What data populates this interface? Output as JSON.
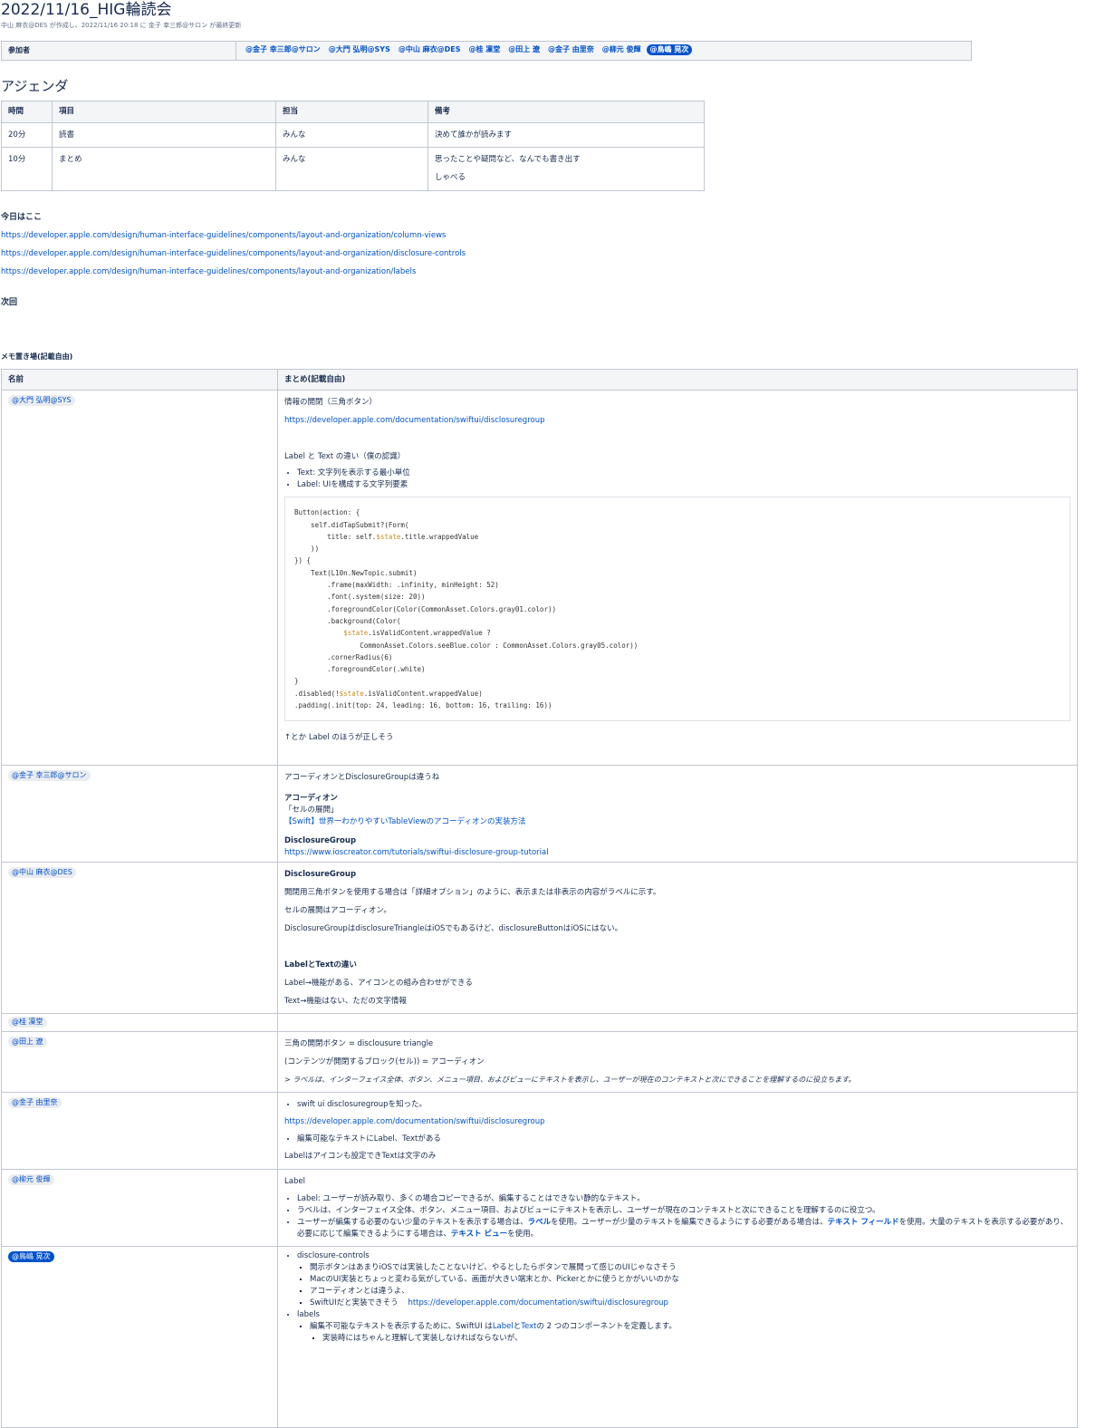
{
  "page": {
    "title": "2022/11/16_HIG輪読会",
    "byline": "中山 麻衣@DES が作成し、2022/11/16 20:18 に 金子 幸三郎@サロン が最終更新"
  },
  "participants": {
    "label": "参加者",
    "mentions": [
      "@金子 幸三郎@サロン",
      "@大門 弘明@SYS",
      "@中山 麻衣@DES",
      "@桂 凜堂",
      "@田上 遼",
      "@金子 由里奈",
      "@柳元 俊輝",
      "@鳥嶋 晃次"
    ]
  },
  "agenda": {
    "heading": "アジェンダ",
    "headers": [
      "時間",
      "項目",
      "担当",
      "備考"
    ],
    "rows": [
      [
        "20分",
        "読書",
        "みんな",
        "決めて誰かが読みます",
        ""
      ],
      [
        "10分",
        "まとめ",
        "みんな",
        "思ったことや疑問など、なんでも書き出す",
        "しゃべる"
      ]
    ]
  },
  "today": {
    "heading": "今日はここ",
    "links": [
      "https://developer.apple.com/design/human-interface-guidelines/components/layout-and-organization/column-views",
      "https://developer.apple.com/design/human-interface-guidelines/components/layout-and-organization/disclosure-controls",
      "https://developer.apple.com/design/human-interface-guidelines/components/layout-and-organization/labels"
    ]
  },
  "next": {
    "heading": "次回"
  },
  "memo": {
    "heading": "メモ置き場(記載自由)",
    "headers": [
      "名前",
      "まとめ(記載自由)"
    ],
    "daimon": {
      "name": "@大門 弘明@SYS",
      "p1": "情報の開閉（三角ボタン）",
      "link1": "https://developer.apple.com/documentation/swiftui/disclosuregroup",
      "p2": "Label と Text の違い（僕の認識）",
      "li1": "Text: 文字列を表示する最小単位",
      "li2": "Label: UIを構成する文字列要素",
      "code": [
        "Button(action: {",
        "    self.didTapSubmit?(Form(",
        "        title: self.",
        "    ))",
        "}) {",
        "    Text(L10n.NewTopic.submit)",
        "        .frame(maxWidth: .infinity, minHeight: 52)",
        "        .font(.system(size: 20))",
        "        .foregroundColor(Color(CommonAsset.Colors.gray01.color))",
        "        .background(Color(",
        "            ",
        "                CommonAsset.Colors.seeBlue.color : CommonAsset.Colors.gray05.color))",
        "        .cornerRadius(6)",
        "        .foregroundColor(.white)",
        "}",
        ".disabled(!",
        ".padding(.init(top: 24, leading: 16, bottom: 16, trailing: 16))"
      ],
      "code_kw": "$state",
      "code_tail": {
        "l3": ".title.wrappedValue",
        "l11": ".isValidContent.wrappedValue ?",
        "l16": ".isValidContent.wrappedValue)"
      },
      "p3": "↑とか Label のほうが正しそう"
    },
    "kaneko": {
      "name": "@金子 幸三郎@サロン",
      "p1": "アコーディオンとDisclosureGroupは違うね",
      "h1": "アコーディオン",
      "p2": "「セルの展開」",
      "link1": "【Swift】世界一わかりやすいTableViewのアコーディオンの実装方法",
      "h2": "DisclosureGroup",
      "link2": "https://www.ioscreator.com/tutorials/swiftui-disclosure-group-tutorial"
    },
    "nakayama": {
      "name": "@中山 麻衣@DES",
      "h1": "DisclosureGroup",
      "p1": "開閉用三角ボタンを使用する場合は「詳細オプション」のように、表示または非表示の内容がラベルに示す。",
      "p2": "セルの展開はアコーディオン。",
      "p3": "DisclosureGroupはdisclosureTriangleはiOSでもあるけど、disclosureButtonはiOSにはない。",
      "h2": "LabelとTextの違い",
      "p4": "Label→機能がある、アイコンとの組み合わせができる",
      "p5": "Text→機能はない、ただの文字情報"
    },
    "katsura": {
      "name": "@桂 凜堂"
    },
    "tagami": {
      "name": "@田上 遼",
      "p1": "三角の開閉ボタン = disclousure triangle",
      "p2": "(コンテンツが開閉するブロック(セル)) = アコーディオン",
      "p3": "> ラベルは、インターフェイス全体、ボタン、メニュー項目、およびビューにテキストを表示し、ユーザーが現在のコンテキストと次にできることを理解するのに役立ちます。"
    },
    "yurina": {
      "name": "@金子 由里奈",
      "li1": "swift ui disclosuregroupを知った。",
      "link1": "https://developer.apple.com/documentation/swiftui/disclosuregroup",
      "li2": "編集可能なテキストにLabel、Textがある",
      "p1": "Labelはアイコンも設定できTextは文字のみ"
    },
    "yanagimoto": {
      "name": "@柳元 俊輝",
      "p1": "Label",
      "li1": "Label: ユーザーが読み取り、多くの場合コピーできるが、編集することはできない静的なテキスト。",
      "li2": "ラベルは、インターフェイス全体、ボタン、メニュー項目、およびビューにテキストを表示し、ユーザーが現在のコンテキストと次にできることを理解するのに役立つ。",
      "li3a": "ユーザーが編集する必要のない少量のテキストを表示する場合は、",
      "li3b": "ラベル",
      "li3c": "を使用。ユーザーが少量のテキストを編集できるようにする必要がある場合は、",
      "li3d": "テキスト フィールド",
      "li3e": "を使用。大量のテキストを表示する必要があり、必要に応じて編集できるようにする場合は、",
      "li3f": "テキスト ビュー",
      "li3g": "を使用。"
    },
    "torishima": {
      "name": "@鳥嶋 晃次",
      "li1": "disclosure-controls",
      "li1a": "開示ボタンはあまりiOSでは実装したことないけど、やるとしたらボタンで展開って感じのUIじゃなさそう",
      "li1b": "MacのUI実装とちょっと変わる気がしている、画面が大きい端末とか、Pickerとかに使うとかがいいのかな",
      "li1c": "アコーディオンとは違うよ、",
      "li1d": "SwiftUIだと実装できそう",
      "li1d_link": "https://developer.apple.com/documentation/swiftui/disclosuregroup",
      "li2": "labels",
      "li2a1": "編集不可能なテキストを表示するために、SwiftUI は",
      "li2a_label": "Label",
      "li2a2": "と",
      "li2a_text": "Text",
      "li2a3": "の 2 つのコンポーネントを定義します。",
      "li2a_sub": "実装時にはちゃんと理解して実装しなければならないが、"
    }
  }
}
